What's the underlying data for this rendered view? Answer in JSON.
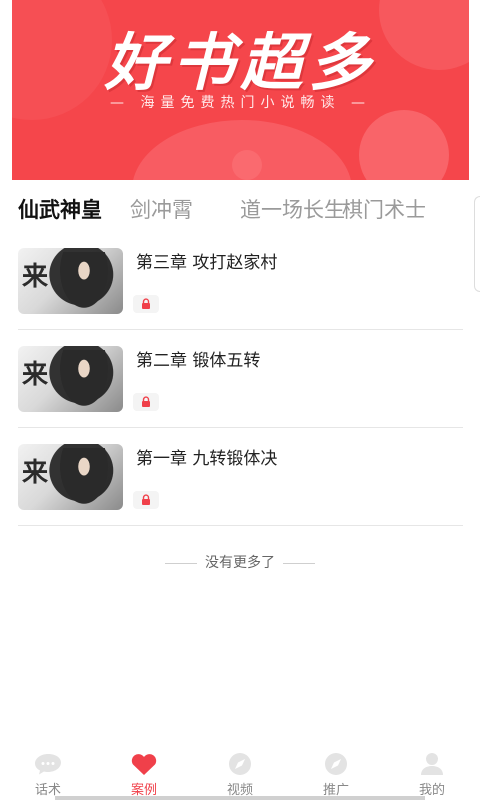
{
  "banner": {
    "title": "好书超多",
    "subtitle": "— 海量免费热门小说畅读 —"
  },
  "tabs": [
    {
      "label": "仙武神皇",
      "active": true
    },
    {
      "label": "剑冲霄",
      "active": false
    },
    {
      "label": "道一场长生",
      "active": false
    },
    {
      "label": "棋门术士",
      "active": false
    }
  ],
  "chapters": [
    {
      "title": "第三章 攻打赵家村",
      "cover_char": "来",
      "locked": true
    },
    {
      "title": "第二章 锻体五转",
      "cover_char": "来",
      "locked": true
    },
    {
      "title": "第一章 九转锻体决",
      "cover_char": "来",
      "locked": true
    }
  ],
  "end_note": "没有更多了",
  "nav": [
    {
      "label": "话术",
      "icon": "chat-bubble-icon",
      "active": false
    },
    {
      "label": "案例",
      "icon": "heart-icon",
      "active": true
    },
    {
      "label": "视频",
      "icon": "compass-icon",
      "active": false
    },
    {
      "label": "推广",
      "icon": "compass-icon",
      "active": false
    },
    {
      "label": "我的",
      "icon": "person-icon",
      "active": false
    }
  ],
  "colors": {
    "accent": "#f0404a",
    "banner": "#f5464b",
    "inactive_icon": "#e3e3e3"
  }
}
